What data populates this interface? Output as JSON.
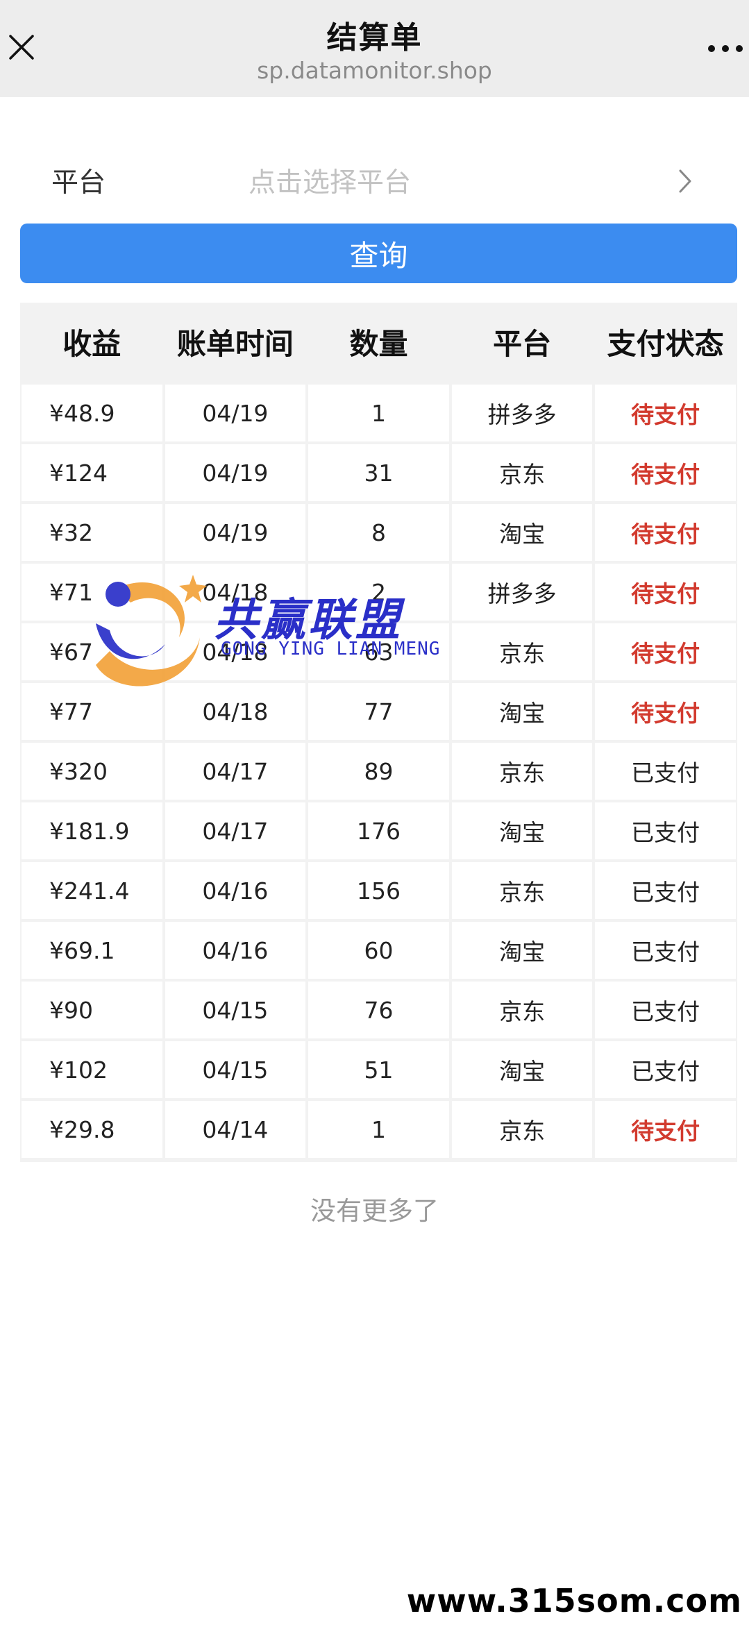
{
  "header": {
    "title": "结算单",
    "url": "sp.datamonitor.shop",
    "close_icon": "close-icon",
    "more_icon": "more-icon"
  },
  "filter": {
    "label": "平台",
    "placeholder": "点击选择平台",
    "arrow_icon": "chevron-right-icon"
  },
  "query_button": "查询",
  "table": {
    "headers": [
      "收益",
      "账单时间",
      "数量",
      "平台",
      "支付状态"
    ],
    "rows": [
      {
        "amount": "¥48.9",
        "date": "04/19",
        "qty": "1",
        "platform": "拼多多",
        "status": "待支付"
      },
      {
        "amount": "¥124",
        "date": "04/19",
        "qty": "31",
        "platform": "京东",
        "status": "待支付"
      },
      {
        "amount": "¥32",
        "date": "04/19",
        "qty": "8",
        "platform": "淘宝",
        "status": "待支付"
      },
      {
        "amount": "¥71",
        "date": "04/18",
        "qty": "2",
        "platform": "拼多多",
        "status": "待支付"
      },
      {
        "amount": "¥67",
        "date": "04/18",
        "qty": "63",
        "platform": "京东",
        "status": "待支付"
      },
      {
        "amount": "¥77",
        "date": "04/18",
        "qty": "77",
        "platform": "淘宝",
        "status": "待支付"
      },
      {
        "amount": "¥320",
        "date": "04/17",
        "qty": "89",
        "platform": "京东",
        "status": "已支付"
      },
      {
        "amount": "¥181.9",
        "date": "04/17",
        "qty": "176",
        "platform": "淘宝",
        "status": "已支付"
      },
      {
        "amount": "¥241.4",
        "date": "04/16",
        "qty": "156",
        "platform": "京东",
        "status": "已支付"
      },
      {
        "amount": "¥69.1",
        "date": "04/16",
        "qty": "60",
        "platform": "淘宝",
        "status": "已支付"
      },
      {
        "amount": "¥90",
        "date": "04/15",
        "qty": "76",
        "platform": "京东",
        "status": "已支付"
      },
      {
        "amount": "¥102",
        "date": "04/15",
        "qty": "51",
        "platform": "淘宝",
        "status": "已支付"
      },
      {
        "amount": "¥29.8",
        "date": "04/14",
        "qty": "1",
        "platform": "京东",
        "status": "待支付"
      }
    ]
  },
  "footer_text": "没有更多了",
  "watermark": {
    "cn": "共赢联盟",
    "en": "GONG YING LIAN MENG"
  },
  "site_mark": "www.315som.com",
  "colors": {
    "accent": "#3c8cf0",
    "pending": "#d23a2e",
    "header_bg": "#ededed"
  }
}
